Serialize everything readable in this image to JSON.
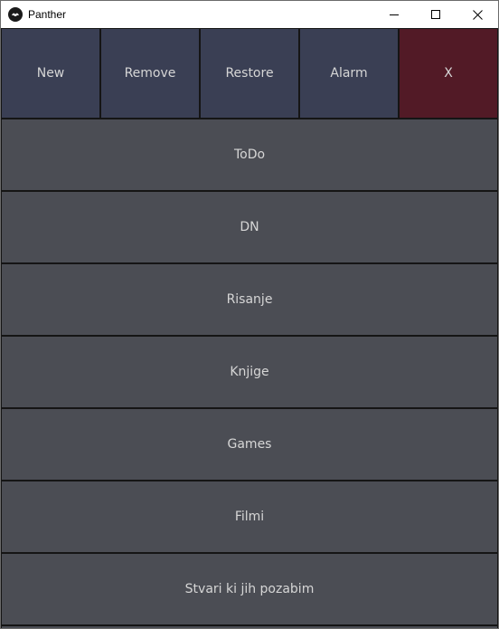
{
  "window": {
    "title": "Panther"
  },
  "toolbar": {
    "buttons": [
      {
        "label": "New"
      },
      {
        "label": "Remove"
      },
      {
        "label": "Restore"
      },
      {
        "label": "Alarm"
      },
      {
        "label": "X"
      }
    ]
  },
  "list": {
    "items": [
      {
        "label": "ToDo"
      },
      {
        "label": "DN"
      },
      {
        "label": "Risanje"
      },
      {
        "label": "Knjige"
      },
      {
        "label": "Games"
      },
      {
        "label": "Filmi"
      },
      {
        "label": "Stvari ki jih pozabim"
      }
    ]
  },
  "colors": {
    "toolbar_button": "#3a3f54",
    "close_button": "#521a26",
    "list_item": "#4b4d54",
    "text": "#d6d6d6",
    "border": "#151515"
  },
  "icons": {
    "app": "panther-app-icon",
    "minimize": "minimize-icon",
    "maximize": "maximize-icon",
    "close": "close-icon"
  }
}
